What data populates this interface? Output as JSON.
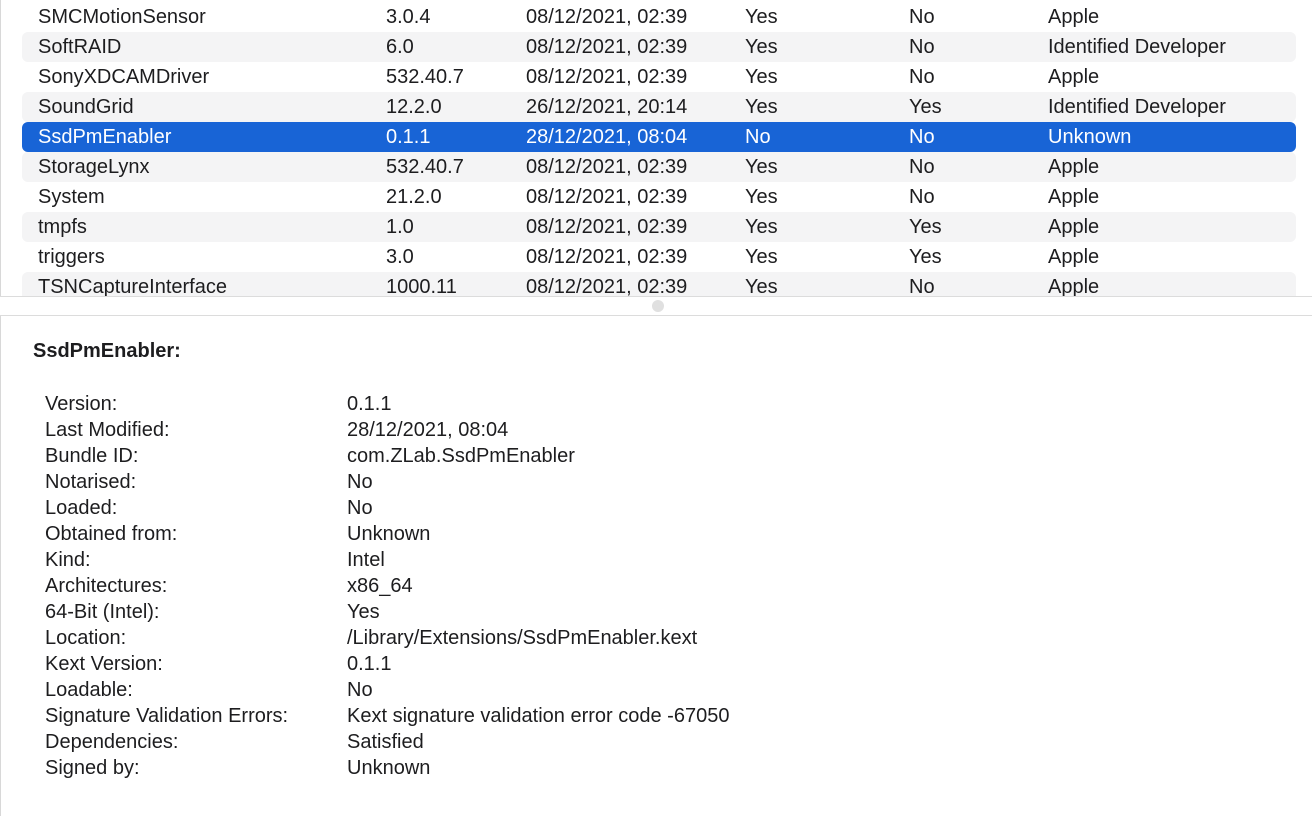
{
  "table": {
    "rows": [
      {
        "name": "SMCMotionSensor",
        "version": "3.0.4",
        "modified": "08/12/2021, 02:39",
        "notarised": "Yes",
        "loaded": "No",
        "obtained": "Apple"
      },
      {
        "name": "SoftRAID",
        "version": "6.0",
        "modified": "08/12/2021, 02:39",
        "notarised": "Yes",
        "loaded": "No",
        "obtained": "Identified Developer"
      },
      {
        "name": "SonyXDCAMDriver",
        "version": "532.40.7",
        "modified": "08/12/2021, 02:39",
        "notarised": "Yes",
        "loaded": "No",
        "obtained": "Apple"
      },
      {
        "name": "SoundGrid",
        "version": "12.2.0",
        "modified": "26/12/2021, 20:14",
        "notarised": "Yes",
        "loaded": "Yes",
        "obtained": "Identified Developer"
      },
      {
        "name": "SsdPmEnabler",
        "version": "0.1.1",
        "modified": "28/12/2021, 08:04",
        "notarised": "No",
        "loaded": "No",
        "obtained": "Unknown"
      },
      {
        "name": "StorageLynx",
        "version": "532.40.7",
        "modified": "08/12/2021, 02:39",
        "notarised": "Yes",
        "loaded": "No",
        "obtained": "Apple"
      },
      {
        "name": "System",
        "version": "21.2.0",
        "modified": "08/12/2021, 02:39",
        "notarised": "Yes",
        "loaded": "No",
        "obtained": "Apple"
      },
      {
        "name": "tmpfs",
        "version": "1.0",
        "modified": "08/12/2021, 02:39",
        "notarised": "Yes",
        "loaded": "Yes",
        "obtained": "Apple"
      },
      {
        "name": "triggers",
        "version": "3.0",
        "modified": "08/12/2021, 02:39",
        "notarised": "Yes",
        "loaded": "Yes",
        "obtained": "Apple"
      },
      {
        "name": "TSNCaptureInterface",
        "version": "1000.11",
        "modified": "08/12/2021, 02:39",
        "notarised": "Yes",
        "loaded": "No",
        "obtained": "Apple"
      }
    ],
    "selected_index": 4
  },
  "detail": {
    "title": "SsdPmEnabler:",
    "fields": [
      {
        "key": "Version:",
        "value": "0.1.1"
      },
      {
        "key": "Last Modified:",
        "value": "28/12/2021, 08:04"
      },
      {
        "key": "Bundle ID:",
        "value": "com.ZLab.SsdPmEnabler"
      },
      {
        "key": "Notarised:",
        "value": "No"
      },
      {
        "key": "Loaded:",
        "value": "No"
      },
      {
        "key": "Obtained from:",
        "value": "Unknown"
      },
      {
        "key": "Kind:",
        "value": "Intel"
      },
      {
        "key": "Architectures:",
        "value": "x86_64"
      },
      {
        "key": "64-Bit (Intel):",
        "value": "Yes"
      },
      {
        "key": "Location:",
        "value": "/Library/Extensions/SsdPmEnabler.kext"
      },
      {
        "key": "Kext Version:",
        "value": "0.1.1"
      },
      {
        "key": "Loadable:",
        "value": "No"
      },
      {
        "key": "Signature Validation Errors:",
        "value": "Kext signature validation error code -67050"
      },
      {
        "key": "Dependencies:",
        "value": "Satisfied"
      },
      {
        "key": "Signed by:",
        "value": "Unknown"
      }
    ]
  },
  "colors": {
    "selection": "#1864d6",
    "alt_row": "#f4f4f5"
  }
}
